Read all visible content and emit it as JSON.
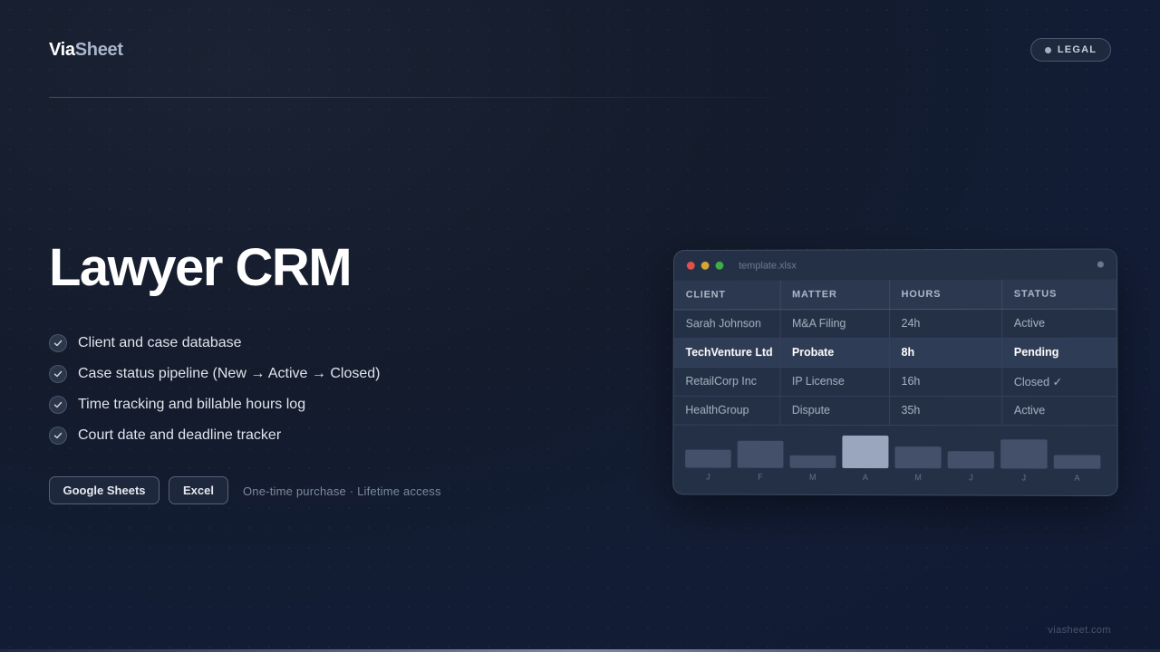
{
  "brand": {
    "part1": "Via",
    "part2": "Sheet"
  },
  "badge": {
    "label": "LEGAL"
  },
  "hero": {
    "title": "Lawyer CRM",
    "features": [
      "Client and case database",
      "Case status pipeline (New → Active → Closed)",
      "Time tracking and billable hours log",
      "Court date and deadline tracker"
    ]
  },
  "buttons": {
    "google_sheets": "Google Sheets",
    "excel": "Excel"
  },
  "purchase_note": "One-time purchase · Lifetime access",
  "footer": {
    "url": "viasheet.com"
  },
  "window": {
    "filename": "template.xlsx",
    "columns": [
      "CLIENT",
      "MATTER",
      "HOURS",
      "STATUS"
    ],
    "rows": [
      [
        "Sarah Johnson",
        "M&A Filing",
        "24h",
        "Active"
      ],
      [
        "TechVenture Ltd",
        "Probate",
        "8h",
        "Pending"
      ],
      [
        "RetailCorp Inc",
        "IP License",
        "16h",
        "Closed ✓"
      ],
      [
        "HealthGroup",
        "Dispute",
        "35h",
        "Active"
      ]
    ],
    "highlighted_row": 1
  },
  "chart_data": {
    "type": "bar",
    "categories": [
      "J",
      "F",
      "M",
      "A",
      "M",
      "J",
      "J",
      "A"
    ],
    "values": [
      20,
      30,
      14,
      36,
      24,
      19,
      32,
      15
    ],
    "highlight_index": 3,
    "colors": {
      "bar": "#44506a",
      "highlight": "#9aa6bd"
    }
  },
  "colors": {
    "accent": "#a9b6cb",
    "background": "#131b2c"
  },
  "icons": {
    "feature_bullet": "check-icon",
    "status_dot": "dot-icon"
  }
}
